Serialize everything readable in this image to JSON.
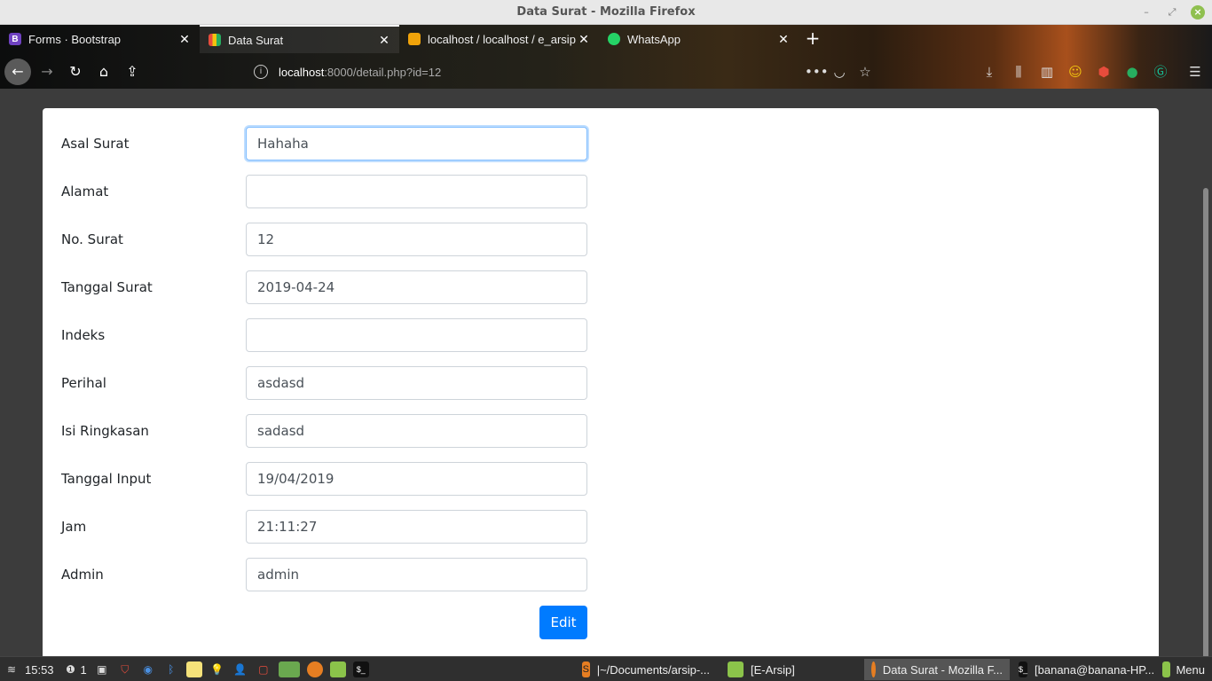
{
  "window": {
    "title": "Data Surat - Mozilla Firefox"
  },
  "tabs": [
    {
      "label": "Forms · Bootstrap",
      "favicon": "B"
    },
    {
      "label": "Data Surat",
      "favicon": ""
    },
    {
      "label": "localhost / localhost / e_arsip",
      "favicon": ""
    },
    {
      "label": "WhatsApp",
      "favicon": ""
    }
  ],
  "url": {
    "host": "localhost",
    "path": ":8000/detail.php?id=12"
  },
  "form": {
    "fields": [
      {
        "label": "Asal Surat",
        "value": "Hahaha"
      },
      {
        "label": "Alamat",
        "value": ""
      },
      {
        "label": "No. Surat",
        "value": "12"
      },
      {
        "label": "Tanggal Surat",
        "value": "2019-04-24"
      },
      {
        "label": "Indeks",
        "value": ""
      },
      {
        "label": "Perihal",
        "value": "asdasd"
      },
      {
        "label": "Isi Ringkasan",
        "value": "sadasd"
      },
      {
        "label": "Tanggal Input",
        "value": "19/04/2019"
      },
      {
        "label": "Jam",
        "value": "21:11:27"
      },
      {
        "label": "Admin",
        "value": "admin"
      }
    ],
    "edit_label": "Edit"
  },
  "taskbar": {
    "clock": "15:53",
    "notifications": "1",
    "tasks": [
      {
        "label": "|~/Documents/arsip-..."
      },
      {
        "label": "[E-Arsip]"
      },
      {
        "label": "Data Surat - Mozilla F..."
      },
      {
        "label": "[banana@banana-HP..."
      }
    ],
    "menu_label": "Menu"
  },
  "colors": {
    "accent": "#007bff",
    "focus_border": "#80bdff"
  }
}
